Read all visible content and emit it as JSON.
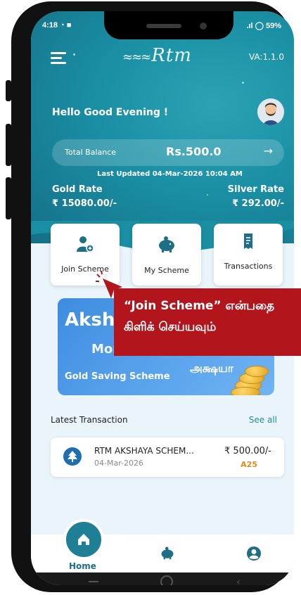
{
  "status_bar": {
    "time": "4:18",
    "battery": "59%"
  },
  "header": {
    "logo_text": "Rtm",
    "version": "VA:1.1.0"
  },
  "greeting": "Hello Good Evening !",
  "balance": {
    "label": "Total Balance",
    "value": "Rs.500.0"
  },
  "last_updated": "Last Updated 04-Mar-2026 10:04 AM",
  "rates": {
    "gold_label": "Gold Rate",
    "gold_value": "₹ 15080.00/-",
    "silver_label": "Silver Rate",
    "silver_value": "₹ 292.00/-"
  },
  "quick_actions": [
    {
      "label": "Join Scheme",
      "icon": "add-user-icon"
    },
    {
      "label": "My Scheme",
      "icon": "piggy-bank-icon"
    },
    {
      "label": "Transactions",
      "icon": "receipt-icon"
    }
  ],
  "banner": {
    "title": "Akshaya",
    "subtitle_line": "Monthly",
    "scheme": "Gold Saving Scheme",
    "tamil_title": "அக்ஷயா"
  },
  "tooltip": {
    "line1": "“Join Scheme” என்பதை",
    "line2": "கிளிக் செய்யவும்"
  },
  "transactions": {
    "header": "Latest Transaction",
    "see_all": "See all",
    "items": [
      {
        "name": "RTM AKSHAYA SCHEM...",
        "date": "04-Mar-2026",
        "amount": "₹ 500.00/-",
        "code": "A25"
      }
    ]
  },
  "bottom_nav": {
    "home_label": "Home"
  },
  "colors": {
    "teal": "#1a8fa4",
    "tooltip_red": "#b3151c",
    "accent_orange": "#e08a1e"
  }
}
